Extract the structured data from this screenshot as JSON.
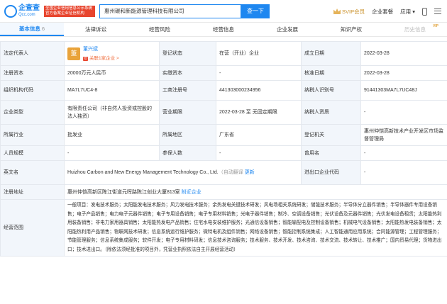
{
  "header": {
    "logo_cn": "企查查",
    "logo_en": "Qcc.com",
    "gov_badge": "全国企业信用信息公示系统 官方备案企业征信机构",
    "search_value": "惠州碳和新能源管理科技有限公司",
    "search_button": "查一下",
    "svip_label": "SVIP会员",
    "menu_packages": "企业套餐",
    "menu_apps": "应用",
    "colors": {
      "brand": "#1e87f0",
      "svip": "#c9902a"
    }
  },
  "tabs": [
    {
      "label": "基本信息",
      "count": "6",
      "active": true
    },
    {
      "label": "法律诉讼"
    },
    {
      "label": "经营风险"
    },
    {
      "label": "经营信息"
    },
    {
      "label": "企业发展"
    },
    {
      "label": "知识产权"
    },
    {
      "label": "历史信息",
      "badge": "VIP"
    }
  ],
  "info": {
    "r1": {
      "l1": "法定代表人",
      "avatar": "董",
      "legal_name": "董兴斌",
      "legal_tag": "ID",
      "legal_sub": "关联1家企业 >",
      "l2": "登记状态",
      "v2": "在营（开业）企业",
      "l3": "成立日期",
      "v3": "2022-03-28"
    },
    "r2": {
      "l1": "注册资本",
      "v1": "20000万元人民币",
      "l2": "实缴资本",
      "v2": "-",
      "l3": "核准日期",
      "v3": "2022-03-28"
    },
    "r3": {
      "l1": "组织机构代码",
      "v1": "MA7L7UC4-8",
      "l2": "工商注册号",
      "v2": "441303000234956",
      "l3": "纳税人识别号",
      "v3": "91441303MA7L7UC48J"
    },
    "r4": {
      "l1": "企业类型",
      "v1": "有限责任公司（非自然人投资或控股的法人独资）",
      "l2": "营业期限",
      "v2": "2022-03-28 至 无固定期限",
      "l3": "纳税人资质",
      "v3": "-"
    },
    "r5": {
      "l1": "所属行业",
      "v1": "批发业",
      "l2": "所属地区",
      "v2": "广东省",
      "l3": "登记机关",
      "v3": "惠州仲恺高新技术产业开发区市场监督管理局"
    },
    "r6": {
      "l1": "人员规模",
      "v1": "-",
      "l2": "参保人数",
      "v2": "-",
      "l3": "曾用名",
      "v3": "-"
    },
    "r7": {
      "l1": "英文名",
      "v1": "Huizhou Carbon and New Energy Management Technology Co., Ltd.",
      "v1_note": "（自动翻译",
      "v1_more": "更新",
      "l3": "进出口企业代码",
      "v3": "-"
    },
    "r8": {
      "l1": "注册地址",
      "v1": "惠州仲恺高新区陈江街道元晖路陈江创业大厦813室",
      "v1_link": "附近企业"
    },
    "r9": {
      "l1": "经营范围",
      "v1": "一般项目：发电技术服务；太阳能发电技术服务；风力发电技术服务；余热发电关键技术研发；风电场相关系统研发；储能技术服务；半导体分立器件销售；半导体器件专用设备销售；电子产品销售；电力电子元器件销售；电子专用设备销售；电子专用材料销售；光电子器件销售；制冷、空调设备销售；光伏设备及元器件销售；光伏发电设备租赁；太阳能热利用装备销售；非电力家用器具销售；太阳能热发电产品销售；住宅水电安装维护服务；光通信设备销售；智能输配电及控制设备销售；机械电气设备销售；太阳能热发电装备销售；太阳能热利用产品销售；物联网技术研发；信息系统运行维护服务；微特电机及组件销售；网络设备销售；智能控制系统集成；人工智能通用应用系统；合同能源管理；工程管理服务；节能管理服务；信息系统集成服务；软件开发；电子专用材料研发；信息技术咨询服务；技术服务、技术开发、技术咨询、技术交流、技术转让、技术推广；国内贸易代理；货物进出口；技术进出口。（除依法须经批准的项目外，凭营业执照依法自主开展经营活动）"
    }
  }
}
